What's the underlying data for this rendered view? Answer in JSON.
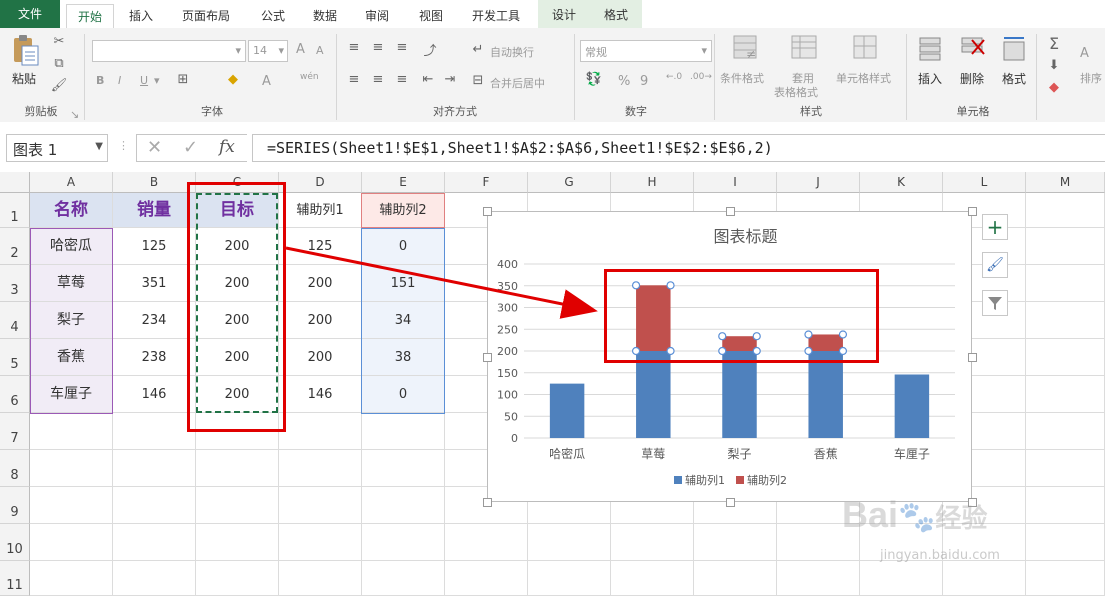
{
  "tabs": [
    "文件",
    "开始",
    "插入",
    "页面布局",
    "公式",
    "数据",
    "审阅",
    "视图",
    "开发工具",
    "设计",
    "格式"
  ],
  "ribbon": {
    "clipboard": {
      "paste": "粘贴",
      "label": "剪贴板"
    },
    "font": {
      "size": "14",
      "label": "字体",
      "bold": "B",
      "italic": "I",
      "underline": "U",
      "grow": "A",
      "shrink": "A",
      "color_a": "A",
      "wen": "wén"
    },
    "align": {
      "wrap": "自动换行",
      "merge": "合并后居中",
      "label": "对齐方式"
    },
    "number": {
      "format": "常规",
      "percent": "%",
      "comma": "9",
      "label": "数字"
    },
    "styles": {
      "cond": "条件格式",
      "table_1": "套用",
      "table_2": "表格格式",
      "cell": "单元格样式",
      "label": "样式"
    },
    "cells": {
      "insert": "插入",
      "delete": "删除",
      "format": "格式",
      "label": "单元格"
    },
    "edit": {
      "sort": "排序"
    }
  },
  "formula_bar": {
    "name_box": "图表 1",
    "cancel": "✕",
    "enter": "✓",
    "fx": "fx",
    "formula": "=SERIES(Sheet1!$E$1,Sheet1!$A$2:$A$6,Sheet1!$E$2:$E$6,2)"
  },
  "columns": [
    "A",
    "B",
    "C",
    "D",
    "E",
    "F",
    "G",
    "H",
    "I",
    "J",
    "K",
    "L",
    "M"
  ],
  "rows": [
    "1",
    "2",
    "3",
    "4",
    "5",
    "6",
    "7",
    "8",
    "9",
    "10",
    "11"
  ],
  "table": {
    "headers": [
      "名称",
      "销量",
      "目标",
      "辅助列1",
      "辅助列2"
    ],
    "rows": [
      [
        "哈密瓜",
        "125",
        "200",
        "125",
        "0"
      ],
      [
        "草莓",
        "351",
        "200",
        "200",
        "151"
      ],
      [
        "梨子",
        "234",
        "200",
        "200",
        "34"
      ],
      [
        "香蕉",
        "238",
        "200",
        "200",
        "38"
      ],
      [
        "车厘子",
        "146",
        "200",
        "146",
        "0"
      ]
    ]
  },
  "colors": {
    "excel_green": "#217346",
    "header_bg": "#dbe3f1",
    "header_purple": "#7030a0",
    "series1": "#4f81bd",
    "series2": "#c0504d",
    "annotation_red": "#e00000"
  },
  "chart_data": {
    "type": "bar",
    "stacked": true,
    "title": "图表标题",
    "categories": [
      "哈密瓜",
      "草莓",
      "梨子",
      "香蕉",
      "车厘子"
    ],
    "series": [
      {
        "name": "辅助列1",
        "values": [
          125,
          200,
          200,
          200,
          146
        ],
        "color": "#4f81bd"
      },
      {
        "name": "辅助列2",
        "values": [
          0,
          151,
          34,
          38,
          0
        ],
        "color": "#c0504d"
      }
    ],
    "yticks": [
      "0",
      "50",
      "100",
      "150",
      "200",
      "250",
      "300",
      "350",
      "400"
    ],
    "ylim": [
      0,
      400
    ],
    "legend": "bottom",
    "grid": true
  },
  "watermark": {
    "line1": "Bai",
    "line2": "经验",
    "url": "jingyan.baidu.com"
  }
}
